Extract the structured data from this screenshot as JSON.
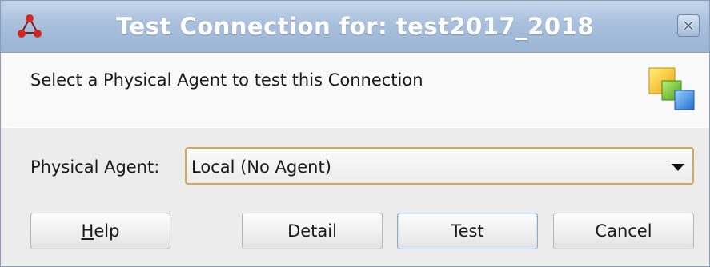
{
  "dialog": {
    "title": "Test Connection for: test2017_2018",
    "header_text": "Select a Physical Agent to test this Connection",
    "close_icon": "close-icon",
    "app_icon": "odi-topology-icon",
    "header_icon": "stacked-squares-icon"
  },
  "form": {
    "agent_label": "Physical Agent:",
    "agent_value": "Local (No Agent)",
    "focus_color": "#d9a55c"
  },
  "buttons": {
    "help_mnemonic": "H",
    "help_rest": "elp",
    "detail": "Detail",
    "test": "Test",
    "cancel": "Cancel"
  }
}
